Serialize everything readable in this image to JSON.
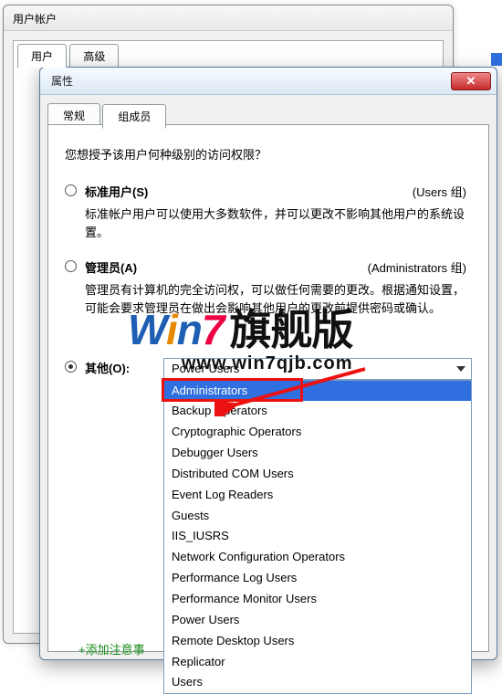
{
  "back_window": {
    "title": "用户帐户",
    "tabs": [
      "用户",
      "高级"
    ]
  },
  "front_window": {
    "title_suffix": "属性",
    "close_glyph": "✕",
    "tabs": {
      "general": "常规",
      "member_of": "组成员"
    },
    "question": "您想授予该用户何种级别的访问权限？",
    "options": {
      "standard": {
        "title": "标准用户(S)",
        "group": "(Users 组)",
        "desc": "标准帐户用户可以使用大多数软件，并可以更改不影响其他用户的系统设置。"
      },
      "admin": {
        "title": "管理员(A)",
        "group": "(Administrators 组)",
        "desc": "管理员有计算机的完全访问权，可以做任何需要的更改。根据通知设置，可能会要求管理员在做出会影响其他用户的更改前提供密码或确认。"
      },
      "other": {
        "title": "其他(O):"
      }
    },
    "dropdown": {
      "selected_display": "Power Users",
      "highlighted": "Administrators",
      "items": [
        "Administrators",
        "Backup Operators",
        "Cryptographic Operators",
        "Debugger Users",
        "Distributed COM Users",
        "Event Log Readers",
        "Guests",
        "IIS_IUSRS",
        "Network Configuration Operators",
        "Performance Log Users",
        "Performance Monitor Users",
        "Power Users",
        "Remote Desktop Users",
        "Replicator",
        "Users"
      ]
    }
  },
  "watermark": {
    "brand_parts": {
      "w": "W",
      "i": "i",
      "n": "n",
      "seven": "7",
      "cn": "旗舰版"
    },
    "url": "www.win7qjb.com"
  },
  "footer_link": "+添加注意事"
}
